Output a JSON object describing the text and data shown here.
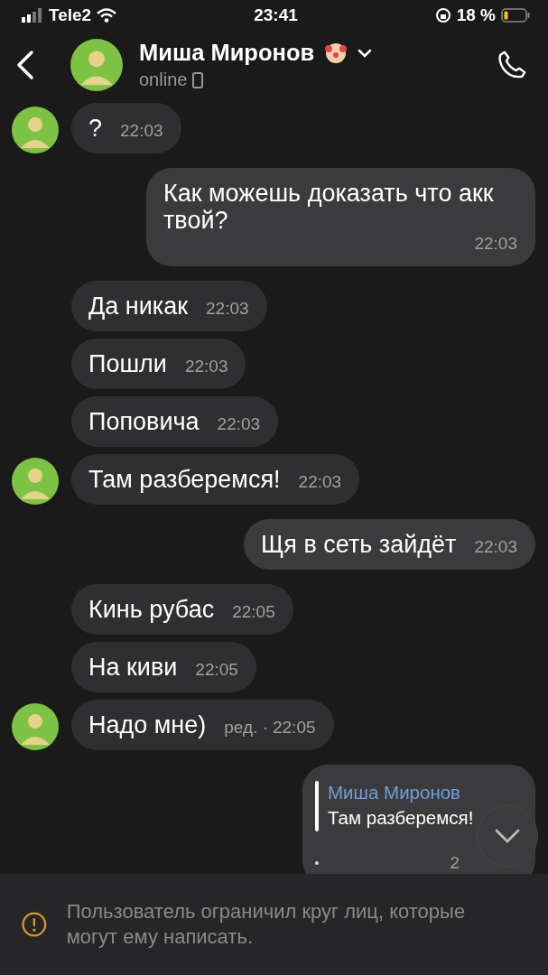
{
  "status_bar": {
    "carrier": "Tele2",
    "time": "23:41",
    "battery": "18 %"
  },
  "header": {
    "name": "Миша Миронов",
    "status": "online"
  },
  "messages": [
    {
      "kind": "incoming",
      "avatar": true,
      "text": "?",
      "time": "22:03"
    },
    {
      "kind": "outgoing",
      "text": "Как можешь доказать что акк твой?",
      "time": "22:03"
    },
    {
      "kind": "incoming",
      "avatar": false,
      "text": "Да никак",
      "time": "22:03"
    },
    {
      "kind": "incoming",
      "avatar": false,
      "text": "Пошли",
      "time": "22:03"
    },
    {
      "kind": "incoming",
      "avatar": false,
      "text": "Поповича",
      "time": "22:03"
    },
    {
      "kind": "incoming",
      "avatar": true,
      "text": "Там разберемся!",
      "time": "22:03"
    },
    {
      "kind": "outgoing",
      "text": "Щя в сеть зайдёт",
      "time": "22:03"
    },
    {
      "kind": "incoming",
      "avatar": false,
      "text": "Кинь рубас",
      "time": "22:05"
    },
    {
      "kind": "incoming",
      "avatar": false,
      "text": "На киви",
      "time": "22:05"
    },
    {
      "kind": "incoming",
      "avatar": true,
      "text": "Надо мне)",
      "edited": "ред. ·",
      "time": "22:05"
    },
    {
      "kind": "outgoing",
      "quote": {
        "author": "Миша Миронов",
        "text": "Там разберемся!"
      },
      "time": "2"
    }
  ],
  "notice": "Пользователь ограничил круг лиц, которые могут ему написать."
}
